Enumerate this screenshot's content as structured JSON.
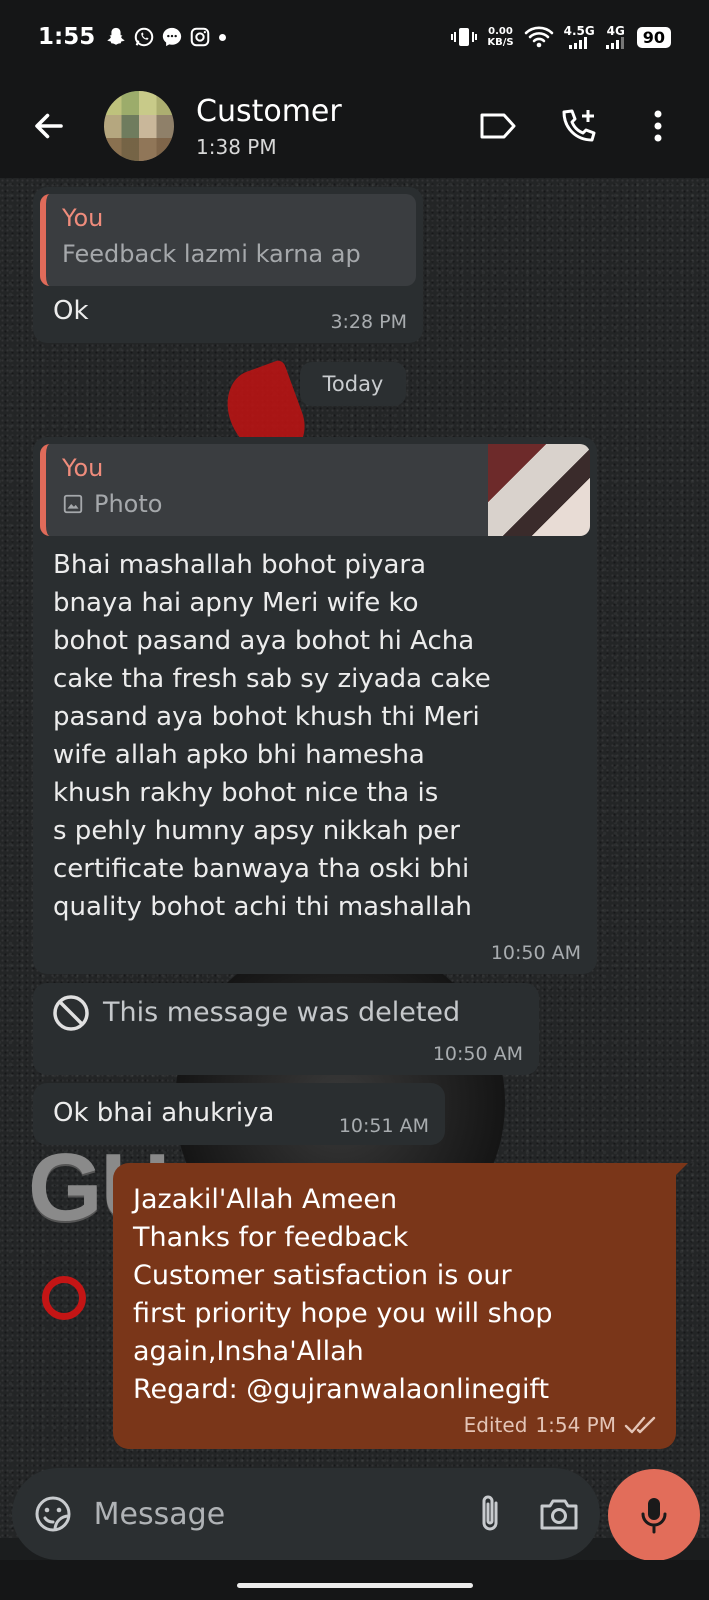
{
  "status_bar": {
    "time": "1:55",
    "net_speed_value": "0.00",
    "net_speed_unit": "KB/S",
    "network_1": "4.5G",
    "network_2": "4G",
    "battery": "90"
  },
  "header": {
    "contact_name": "Customer",
    "last_seen": "1:38 PM"
  },
  "messages": [
    {
      "direction": "incoming",
      "quote_author": "You",
      "quote_text": "Feedback lazmi karna ap",
      "text": "Ok",
      "time": "3:28 PM"
    },
    {
      "direction": "date",
      "text": "Today"
    },
    {
      "direction": "incoming",
      "quote_author": "You",
      "quote_text": "Photo",
      "lines": [
        "Bhai mashallah bohot piyara",
        "bnaya hai apny Meri wife ko",
        "bohot pasand aya bohot hi Acha",
        "cake tha fresh sab sy ziyada cake",
        "pasand aya bohot khush thi Meri",
        "wife allah apko bhi hamesha",
        "khush rakhy bohot nice tha is",
        "s pehly humny apsy nikkah per",
        "certificate banwaya tha oski bhi",
        "quality bohot achi thi mashallah"
      ],
      "time": "10:50 AM"
    },
    {
      "direction": "incoming",
      "deleted": true,
      "text": "This message was deleted",
      "time": "10:50 AM"
    },
    {
      "direction": "incoming",
      "text": "Ok bhai ahukriya",
      "time": "10:51 AM"
    },
    {
      "direction": "outgoing",
      "lines": [
        "Jazakil'Allah Ameen",
        "Thanks for feedback",
        "Customer satisfaction is our",
        "first priority hope you will shop",
        "again,Insha'Allah",
        "Regard: @gujranwalaonlinegift"
      ],
      "edited_label": "Edited",
      "time": "1:54 PM"
    }
  ],
  "composer": {
    "placeholder": "Message"
  },
  "colors": {
    "outgoing_bubble": "#7a3619",
    "incoming_bubble": "#2a2e30",
    "accent": "#e26d5a"
  }
}
